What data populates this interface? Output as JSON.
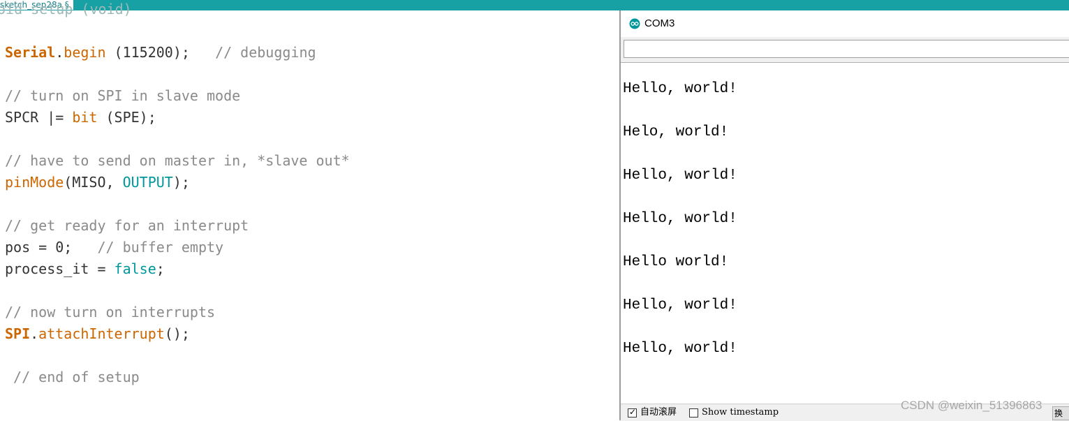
{
  "editor": {
    "tab_label": "sketch_sep28a §",
    "top_partial": "oid setup (void)",
    "lines": {
      "l1_serial": "Serial",
      "l1_dot": ".",
      "l1_begin": "begin",
      "l1_args": " (115200);   ",
      "l1_comment": "// debugging",
      "l2_comment": "// turn on SPI in slave mode",
      "l3_spcr": "SPCR |= ",
      "l3_bit": "bit",
      "l3_args": " (SPE);",
      "l4_comment": "// have to send on master in, *slave out*",
      "l5_pinmode": "pinMode",
      "l5_open": "(MISO, ",
      "l5_output": "OUTPUT",
      "l5_close": ");",
      "l6_comment": "// get ready for an interrupt",
      "l7_pos": "pos = 0;   ",
      "l7_comment": "// buffer empty",
      "l8_proc": "process_it = ",
      "l8_false": "false",
      "l8_semi": ";",
      "l9_comment": "// now turn on interrupts",
      "l10_spi": "SPI",
      "l10_dot": ".",
      "l10_attach": "attachInterrupt",
      "l10_args": "();",
      "l11_comment": " // end of setup"
    }
  },
  "monitor": {
    "title": "COM3",
    "input_value": "",
    "output": [
      "Hello, world!",
      "Helo, world!",
      "Hello, world!",
      "Hello, world!",
      "Hello world!",
      "Hello, world!",
      "Hello, world!"
    ],
    "autoscroll_label": "自动滚屏",
    "autoscroll_checked": true,
    "timestamp_label": "Show timestamp",
    "timestamp_checked": false,
    "line_ending_button": "换行"
  },
  "watermark": "CSDN @weixin_51396863",
  "colors": {
    "topbar": "#17a1a5",
    "keyword": "#cc6600",
    "constant": "#00979c",
    "comment": "#8a8a8a"
  }
}
